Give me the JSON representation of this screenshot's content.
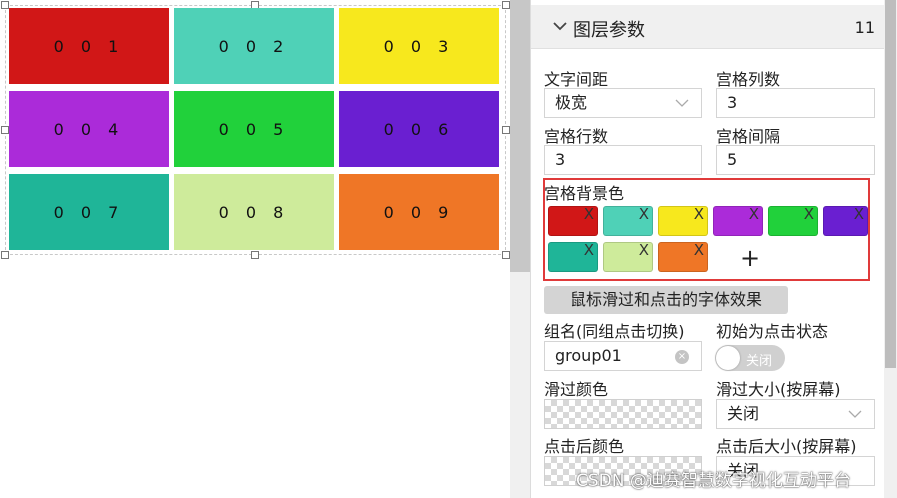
{
  "canvas": {
    "cells": [
      {
        "label": "0 0 1",
        "color": "#d11717"
      },
      {
        "label": "0 0 2",
        "color": "#4fd1b7"
      },
      {
        "label": "0 0 3",
        "color": "#f7e81d"
      },
      {
        "label": "0 0 4",
        "color": "#ab2bd9"
      },
      {
        "label": "0 0 5",
        "color": "#21d13b"
      },
      {
        "label": "0 0 6",
        "color": "#6a1fd1"
      },
      {
        "label": "0 0 7",
        "color": "#1fb598"
      },
      {
        "label": "0 0 8",
        "color": "#ceeb9b"
      },
      {
        "label": "0 0 9",
        "color": "#ef7626"
      }
    ]
  },
  "panel": {
    "header": {
      "title": "图层参数",
      "count": "11"
    },
    "text_spacing": {
      "label": "文字间距",
      "value": "极宽"
    },
    "grid_columns": {
      "label": "宫格列数",
      "value": "3"
    },
    "grid_rows": {
      "label": "宫格行数",
      "value": "3"
    },
    "grid_gap": {
      "label": "宫格间隔",
      "value": "5"
    },
    "bg_colors": {
      "label": "宫格背景色",
      "swatches": [
        "#d11717",
        "#4fd1b7",
        "#f7e81d",
        "#ab2bd9",
        "#21d13b",
        "#6a1fd1",
        "#1fb598",
        "#ceeb9b",
        "#ef7626"
      ],
      "remove_glyph": "X",
      "add_glyph": "+"
    },
    "effect_button": "鼠标滑过和点击的字体效果",
    "group_name": {
      "label": "组名(同组点击切换)",
      "value": "group01",
      "clear_glyph": "×"
    },
    "initial_click": {
      "label": "初始为点击状态",
      "toggle_text": "关闭"
    },
    "hover_color": {
      "label": "滑过颜色"
    },
    "hover_size": {
      "label": "滑过大小(按屏幕)",
      "value": "关闭"
    },
    "click_color": {
      "label": "点击后颜色"
    },
    "click_size": {
      "label": "点击后大小(按屏幕)",
      "value": "关闭"
    }
  },
  "watermark": "CSDN @迪赛智慧数字视化互动平台"
}
